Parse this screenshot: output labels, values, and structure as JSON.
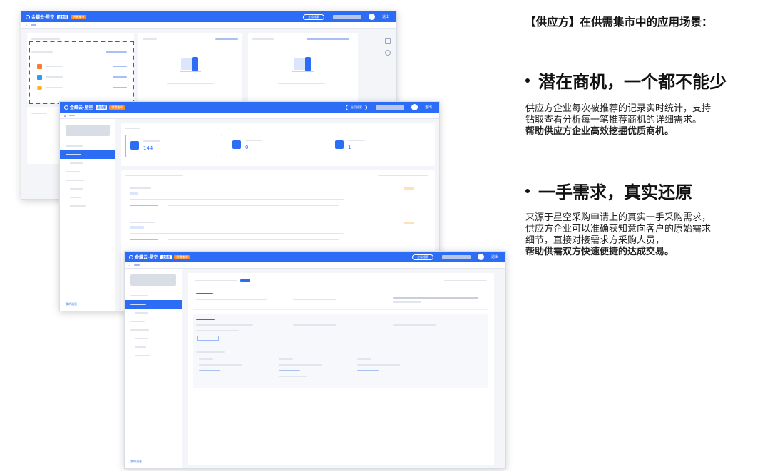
{
  "heading": "【供应方】在供需集市中的应用场景：",
  "bullets": [
    {
      "title": "潜在商机，一个都不能少",
      "lines": [
        "供应方企业每次被推荐的记录实时统计，支持",
        "钻取查看分析每一笔推荐商机的详细需求。"
      ],
      "bold": "帮助供应方企业高效挖掘优质商机。"
    },
    {
      "title": "一手需求，真实还原",
      "lines": [
        "来源于星空采购申请上的真实一手采购需求，",
        "供应方企业可以准确获知意向客户的原始需求",
        "细节，直接对接需求方采购人员，"
      ],
      "bold": "帮助供需双方快速便捷的达成交易。"
    }
  ],
  "app": {
    "logo": "金蝶云·星空",
    "badge": "企业版",
    "tag": "供需集市",
    "search": "全局搜索",
    "user_menu": "退出",
    "stats": [
      {
        "label": "推荐商机",
        "value": "144"
      },
      {
        "label": "商机查看",
        "value": "0"
      },
      {
        "label": "商机收藏",
        "value": "1"
      }
    ],
    "empty_count": "0",
    "sidebar_bottom": "我的消息"
  },
  "colors": {
    "brand": "#2d6df6",
    "highlight_border": "#d9232e",
    "orange": "#ff8a1f"
  }
}
